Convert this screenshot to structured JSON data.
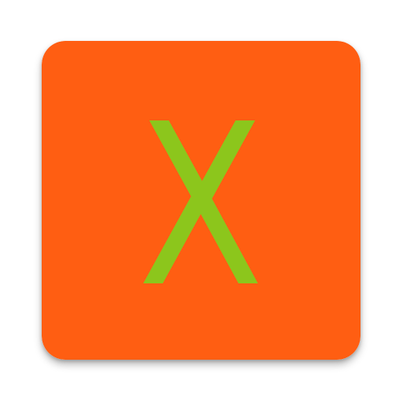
{
  "icon": {
    "glyph": "X",
    "background_color": "#FF5E12",
    "glyph_color": "#8CC61C"
  }
}
